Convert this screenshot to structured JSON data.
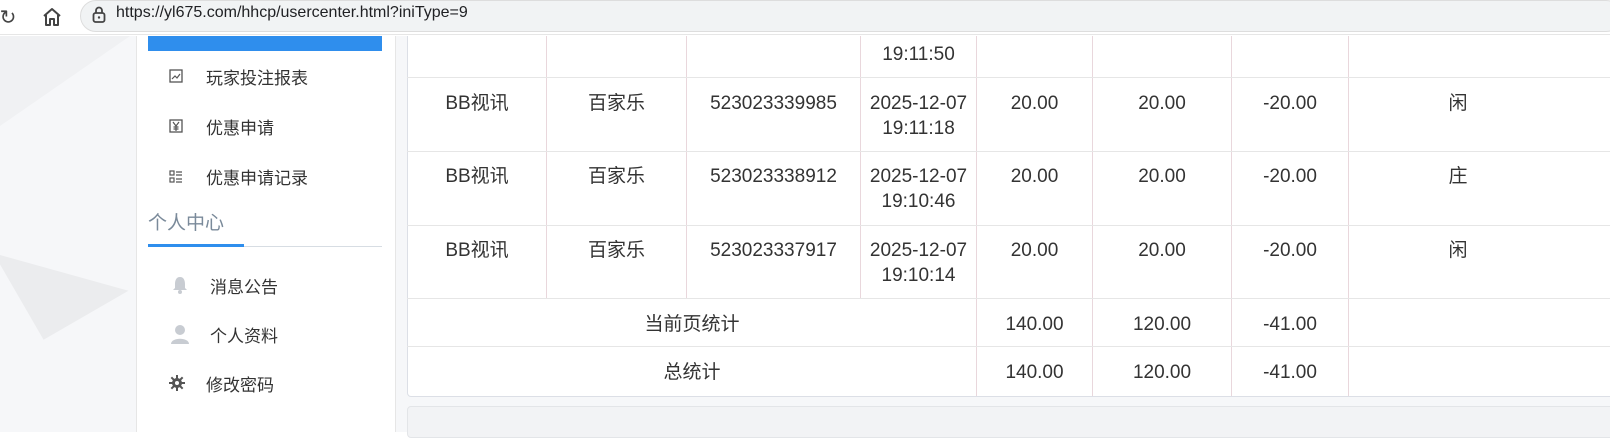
{
  "browser": {
    "url": "https://yl675.com/hhcp/usercenter.html?iniType=9"
  },
  "sidebar": {
    "items_top": [
      {
        "label": "玩家投注报表",
        "icon": "image-icon"
      },
      {
        "label": "优惠申请",
        "icon": "yen-icon"
      },
      {
        "label": "优惠申请记录",
        "icon": "list-icon"
      }
    ],
    "section_title": "个人中心",
    "items_personal": [
      {
        "label": "消息公告",
        "icon": "bell-icon"
      },
      {
        "label": "个人资料",
        "icon": "user-icon"
      },
      {
        "label": "修改密码",
        "icon": "gear-icon"
      }
    ]
  },
  "table": {
    "partial_row": {
      "time": "19:11:50"
    },
    "rows": [
      {
        "platform": "BB视讯",
        "game": "百家乐",
        "bet_no": "523023339985",
        "date": "2025-12-07",
        "time": "19:11:18",
        "bet": "20.00",
        "valid": "20.00",
        "win": "-20.00",
        "result": "闲"
      },
      {
        "platform": "BB视讯",
        "game": "百家乐",
        "bet_no": "523023338912",
        "date": "2025-12-07",
        "time": "19:10:46",
        "bet": "20.00",
        "valid": "20.00",
        "win": "-20.00",
        "result": "庄"
      },
      {
        "platform": "BB视讯",
        "game": "百家乐",
        "bet_no": "523023337917",
        "date": "2025-12-07",
        "time": "19:10:14",
        "bet": "20.00",
        "valid": "20.00",
        "win": "-20.00",
        "result": "闲"
      }
    ],
    "page_total": {
      "label": "当前页统计",
      "bet": "140.00",
      "valid": "120.00",
      "win": "-41.00"
    },
    "grand_total": {
      "label": "总统计",
      "bet": "140.00",
      "valid": "120.00",
      "win": "-41.00"
    }
  },
  "colors": {
    "accent": "#2f8eed"
  }
}
